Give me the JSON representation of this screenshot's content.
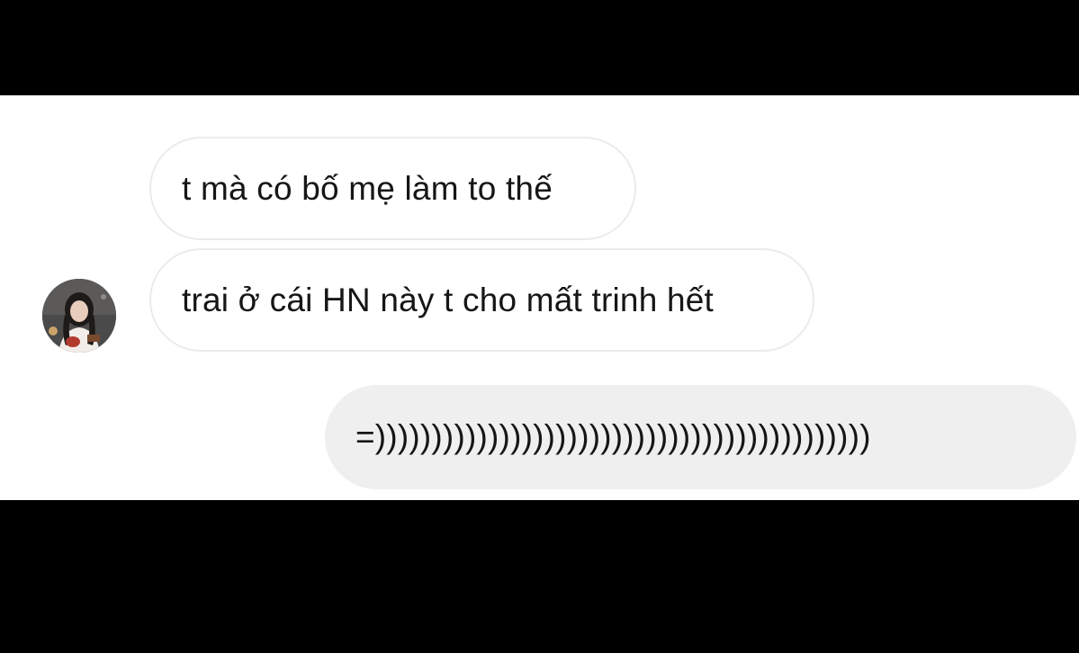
{
  "conversation": {
    "messages": [
      {
        "direction": "incoming",
        "text": "t mà có bố mẹ làm to thế"
      },
      {
        "direction": "incoming",
        "text": "trai ở cái HN này t cho mất trinh hết"
      },
      {
        "direction": "outgoing",
        "text": "=))))))))))))))))))))))))))))))))))))))))))))"
      }
    ],
    "avatar": {
      "icon": "profile-photo-icon"
    }
  },
  "colors": {
    "letterbox": "#000000",
    "background": "#ffffff",
    "incoming_border": "#ebebeb",
    "outgoing_bubble": "#efefef",
    "text": "#161616"
  }
}
